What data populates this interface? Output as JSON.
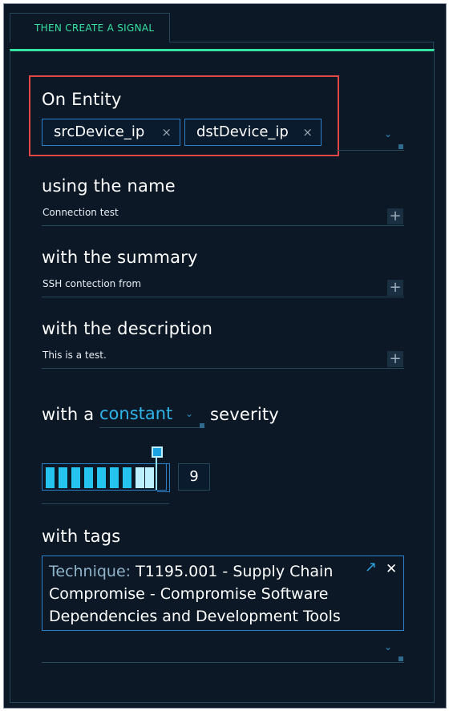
{
  "step_title": "THEN CREATE A SIGNAL",
  "entity": {
    "label": "On Entity",
    "chips": [
      "srcDevice_ip",
      "dstDevice_ip"
    ],
    "remove_symbol": "×"
  },
  "name": {
    "label": "using the name",
    "value": "Connection test"
  },
  "summary": {
    "label": "with the summary",
    "value": "SSH contection from"
  },
  "description": {
    "label": "with the description",
    "value": "This is a test."
  },
  "severity": {
    "prefix": "with a",
    "mode": "constant",
    "suffix": "severity",
    "value": "9",
    "max": 10
  },
  "tags": {
    "label": "with tags",
    "items": [
      {
        "key": "Technique:",
        "value": "T1195.001 - Supply Chain Compromise - Compromise Software Dependencies and Development Tools"
      }
    ]
  },
  "colors": {
    "accent_green": "#35e3a2",
    "accent_blue": "#2fb4e8",
    "highlight_red": "#e04848",
    "background": "#0c1826"
  },
  "icons": {
    "plus": "+",
    "chevron": "⌄",
    "close": "✕",
    "external_link": "↗"
  }
}
